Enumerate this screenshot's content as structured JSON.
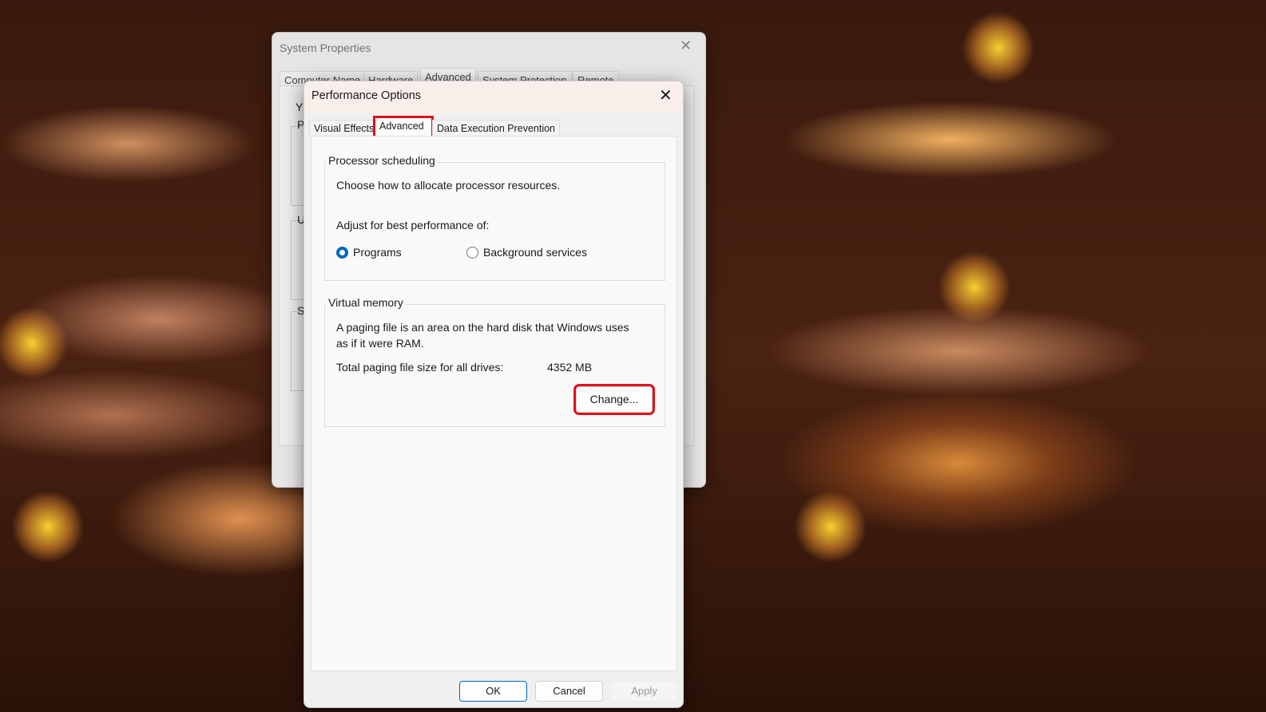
{
  "background_window": {
    "title": "System Properties",
    "tabs": [
      "Computer Name",
      "Hardware",
      "Advanced",
      "System Protection",
      "Remote"
    ],
    "active_tab": "Advanced",
    "partial_letters": [
      "Y",
      "P",
      "U",
      "S"
    ]
  },
  "dialog": {
    "title": "Performance Options",
    "tabs": [
      "Visual Effects",
      "Advanced",
      "Data Execution Prevention"
    ],
    "active_tab": "Advanced",
    "processor": {
      "legend": "Processor scheduling",
      "description": "Choose how to allocate processor resources.",
      "adjust_label": "Adjust for best performance of:",
      "options": [
        {
          "label": "Programs",
          "selected": true
        },
        {
          "label": "Background services",
          "selected": false
        }
      ]
    },
    "virtual_memory": {
      "legend": "Virtual memory",
      "description_line1": "A paging file is an area on the hard disk that Windows uses",
      "description_line2": "as if it were RAM.",
      "total_label": "Total paging file size for all drives:",
      "total_value": "4352 MB",
      "change_button": "Change..."
    },
    "buttons": {
      "ok": "OK",
      "cancel": "Cancel",
      "apply": "Apply"
    }
  },
  "colors": {
    "accent": "#0067c0",
    "highlight": "#e0101a"
  }
}
